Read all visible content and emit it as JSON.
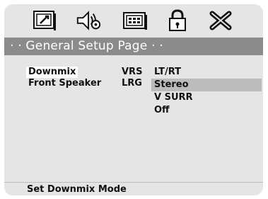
{
  "header": {
    "icons": [
      "general-setup-icon",
      "audio-setup-icon",
      "video-setup-icon",
      "password-lock-icon",
      "exit-icon"
    ],
    "title": "· · General Setup Page · ·"
  },
  "settings": [
    {
      "label": "Downmix",
      "value": "VRS"
    },
    {
      "label": "Front Speaker",
      "value": "LRG"
    }
  ],
  "options": [
    "LT/RT",
    "Stereo",
    "V SURR",
    "Off"
  ],
  "selected_option": "Stereo",
  "footer": {
    "hint": "Set Downmix Mode"
  },
  "colors": {
    "panel": "#e5e5e5",
    "title_bar": "#8b8b8b",
    "highlight": "#bcbcbc"
  }
}
